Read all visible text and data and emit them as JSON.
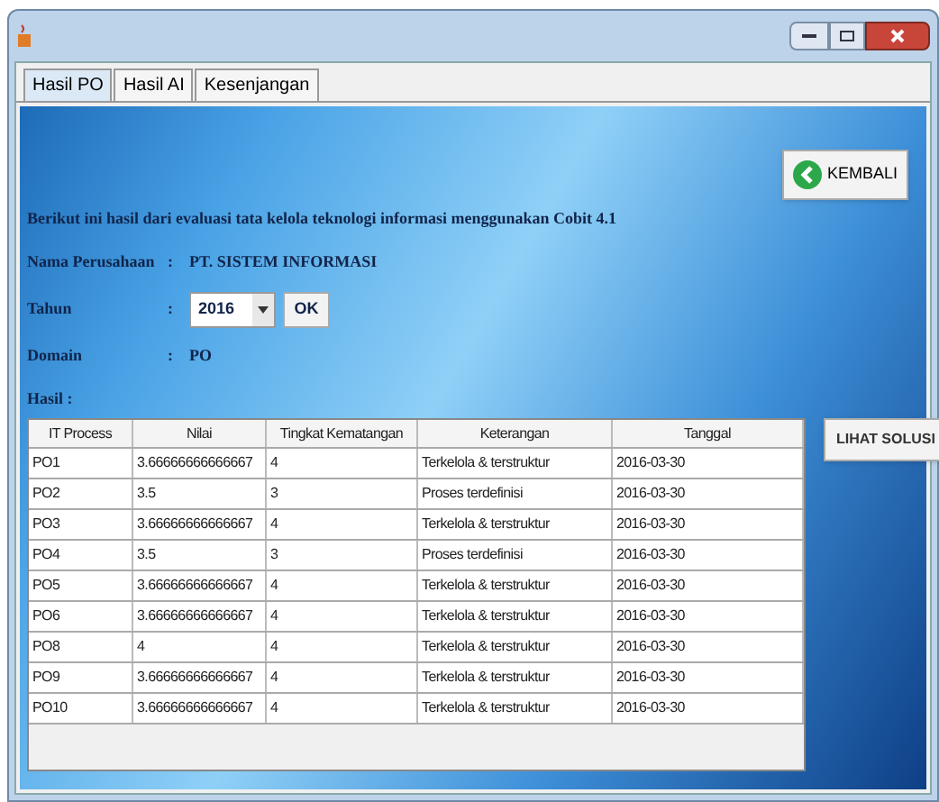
{
  "tabs": [
    {
      "label": "Hasil PO",
      "selected": true
    },
    {
      "label": "Hasil AI",
      "selected": false
    },
    {
      "label": "Kesenjangan",
      "selected": false
    }
  ],
  "back_button": {
    "label": "KEMBALI"
  },
  "intro": "Berikut ini hasil dari evaluasi tata kelola teknologi informasi menggunakan Cobit 4.1",
  "fields": [
    {
      "kind": "text",
      "label": "Nama Perusahaan",
      "separator": ":",
      "value": "PT. SISTEM INFORMASI"
    },
    {
      "kind": "select",
      "label": "Tahun",
      "separator": ":",
      "value": "2016",
      "button": "OK"
    },
    {
      "kind": "text",
      "label": "Domain",
      "separator": ":",
      "value": "PO"
    }
  ],
  "result_label": "Hasil :",
  "table": {
    "columns": [
      "IT Process",
      "Nilai",
      "Tingkat Kematangan",
      "Keterangan",
      "Tanggal"
    ],
    "rows": [
      [
        "PO1",
        "3.66666666666667",
        "4",
        "Terkelola & terstruktur",
        "2016-03-30"
      ],
      [
        "PO2",
        "3.5",
        "3",
        "Proses terdefinisi",
        "2016-03-30"
      ],
      [
        "PO3",
        "3.66666666666667",
        "4",
        "Terkelola & terstruktur",
        "2016-03-30"
      ],
      [
        "PO4",
        "3.5",
        "3",
        "Proses terdefinisi",
        "2016-03-30"
      ],
      [
        "PO5",
        "3.66666666666667",
        "4",
        "Terkelola & terstruktur",
        "2016-03-30"
      ],
      [
        "PO6",
        "3.66666666666667",
        "4",
        "Terkelola & terstruktur",
        "2016-03-30"
      ],
      [
        "PO8",
        "4",
        "4",
        "Terkelola & terstruktur",
        "2016-03-30"
      ],
      [
        "PO9",
        "3.66666666666667",
        "4",
        "Terkelola & terstruktur",
        "2016-03-30"
      ],
      [
        "PO10",
        "3.66666666666667",
        "4",
        "Terkelola & terstruktur",
        "2016-03-30"
      ]
    ]
  },
  "solution_button": {
    "label": "LIHAT SOLUSI"
  }
}
